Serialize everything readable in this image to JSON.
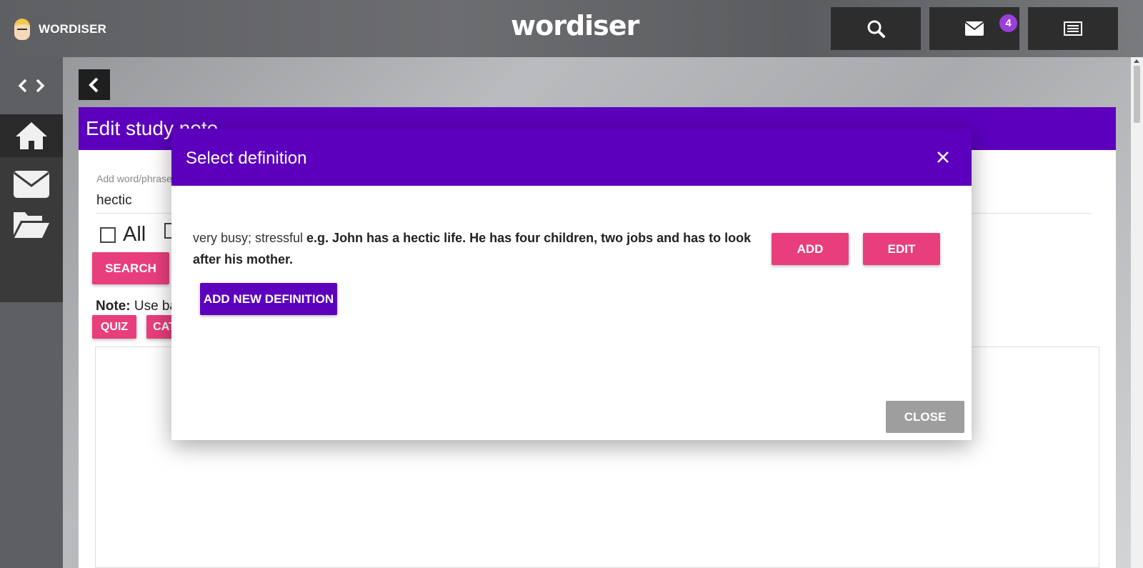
{
  "app": {
    "brand_small": "WORDISER",
    "logo": "wordiser"
  },
  "topbar": {
    "icons": [
      "search-icon",
      "mail-icon",
      "list-icon"
    ],
    "mail_badge": "4"
  },
  "sidebar": {
    "items": [
      {
        "icon": "code-icon"
      },
      {
        "icon": "home-icon"
      },
      {
        "icon": "mail-icon"
      },
      {
        "icon": "folder-open-icon"
      }
    ]
  },
  "main": {
    "title": "Edit study note",
    "field_label": "Add word/phrase",
    "field_value": "hectic",
    "checkbox_all": "All",
    "search_button": "SEARCH",
    "note_label": "Note:",
    "note_text": "Use ba",
    "quiz_button": "QUIZ",
    "cat_button": "CAT"
  },
  "modal": {
    "title": "Select definition",
    "definition_plain": "very busy; stressful ",
    "definition_example": "e.g. John has a hectic life. He has four children, two jobs and has to look after his mother.",
    "add_button": "ADD",
    "edit_button": "EDIT",
    "add_new_button": "ADD NEW DEFINITION",
    "close_button": "CLOSE"
  },
  "colors": {
    "primary": "#5c00bd",
    "accent": "#e83e7c",
    "badge": "#9b3fd8",
    "close_button": "#9e9e9e"
  }
}
